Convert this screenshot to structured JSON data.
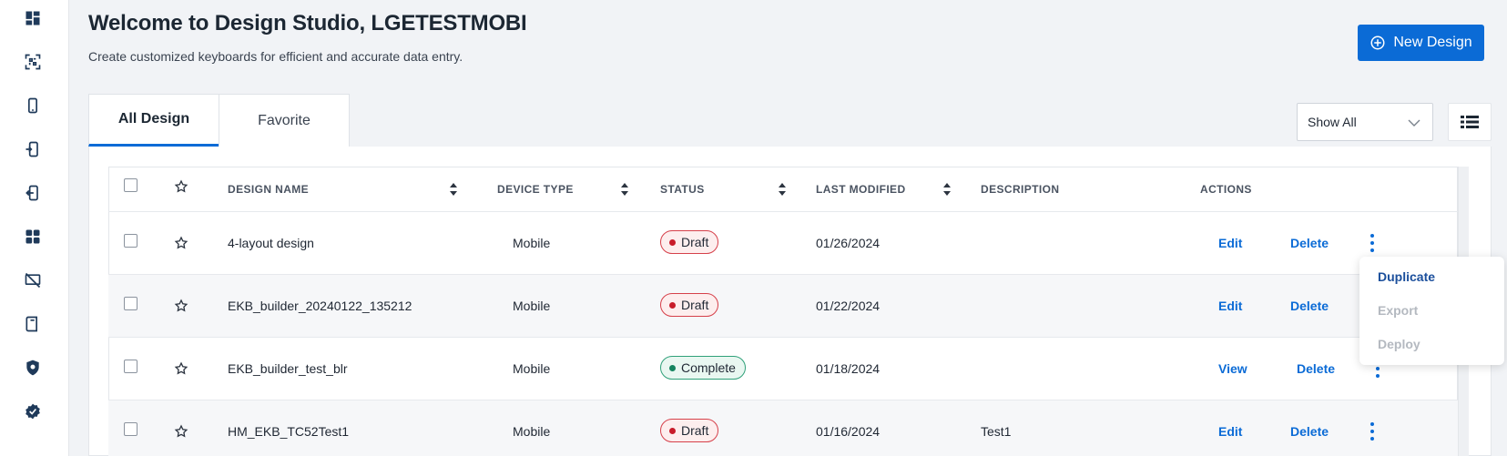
{
  "header": {
    "title": "Welcome to Design Studio, LGETESTMOBI",
    "subtitle": "Create customized keyboards for efficient and accurate data entry.",
    "new_design_label": "New Design"
  },
  "sidebar": {
    "items": [
      {
        "icon": "dashboard-icon"
      },
      {
        "icon": "barcode-scan-icon"
      },
      {
        "icon": "mobile-device-icon"
      },
      {
        "icon": "device-import-icon"
      },
      {
        "icon": "device-export-icon"
      },
      {
        "icon": "apps-grid-icon"
      },
      {
        "icon": "screen-off-icon"
      },
      {
        "icon": "book-icon"
      },
      {
        "icon": "shield-icon"
      },
      {
        "icon": "verified-badge-icon"
      }
    ]
  },
  "tabs": [
    {
      "label": "All Design",
      "active": true
    },
    {
      "label": "Favorite",
      "active": false
    }
  ],
  "filter": {
    "selected": "Show All"
  },
  "table": {
    "columns": [
      "DESIGN NAME",
      "DEVICE TYPE",
      "STATUS",
      "LAST MODIFIED",
      "DESCRIPTION",
      "ACTIONS"
    ],
    "rows": [
      {
        "name": "4-layout design",
        "device": "Mobile",
        "status": "Draft",
        "modified": "01/26/2024",
        "description": "",
        "primary_action": "Edit",
        "secondary_action": "Delete"
      },
      {
        "name": "EKB_builder_20240122_135212",
        "device": "Mobile",
        "status": "Draft",
        "modified": "01/22/2024",
        "description": "",
        "primary_action": "Edit",
        "secondary_action": "Delete"
      },
      {
        "name": "EKB_builder_test_blr",
        "device": "Mobile",
        "status": "Complete",
        "modified": "01/18/2024",
        "description": "",
        "primary_action": "View",
        "secondary_action": "Delete"
      },
      {
        "name": "HM_EKB_TC52Test1",
        "device": "Mobile",
        "status": "Draft",
        "modified": "01/16/2024",
        "description": "Test1",
        "primary_action": "Edit",
        "secondary_action": "Delete"
      }
    ]
  },
  "context_menu": {
    "items": [
      {
        "label": "Duplicate",
        "enabled": true
      },
      {
        "label": "Export",
        "enabled": false
      },
      {
        "label": "Deploy",
        "enabled": false
      }
    ]
  },
  "colors": {
    "accent": "#0b6bd6",
    "draft": "#c81c2a",
    "complete": "#14845f",
    "menu_link": "#1b4f9c"
  }
}
